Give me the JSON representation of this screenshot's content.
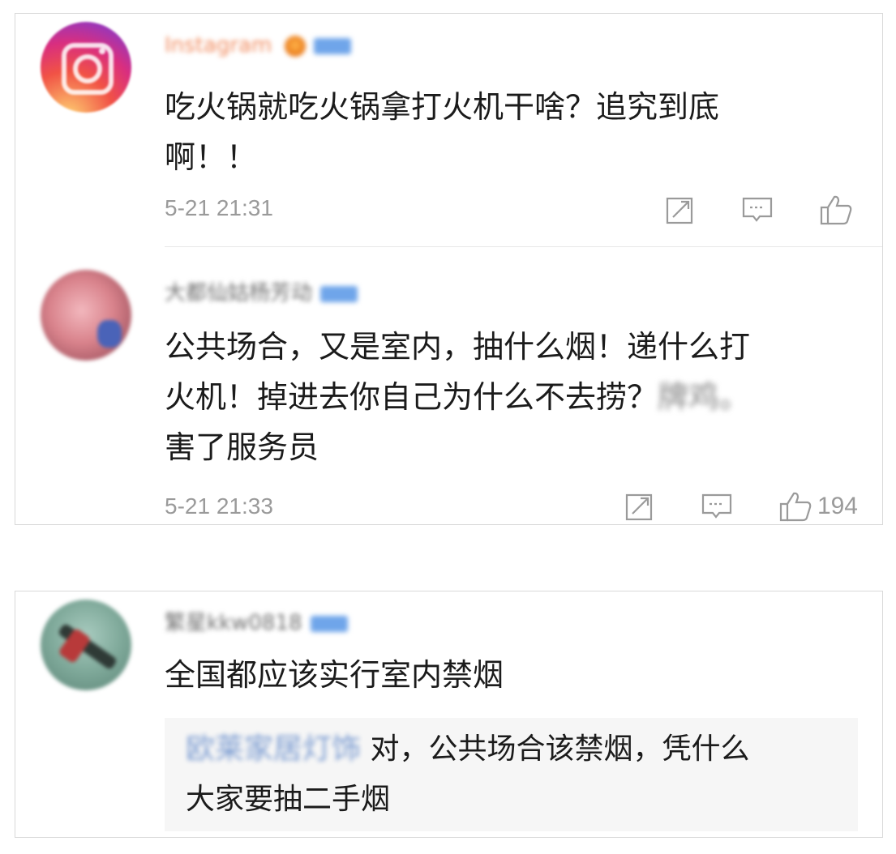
{
  "comments": [
    {
      "username": "Instagram",
      "text_line1": "吃火锅就吃火锅拿打火机干啥？追究到底",
      "text_line2": "啊！！",
      "time": "5-21 21:31",
      "like_count": ""
    },
    {
      "username": "大都仙姑杨芳动",
      "text_line1": "公共场合，又是室内，抽什么烟！递什么打",
      "text_line2_prefix": "火机！掉进去你自己为什么不去捞？",
      "text_line2_blurred": "牌鸡。",
      "text_line3": "害了服务员",
      "time": "5-21 21:33",
      "like_count": "194"
    },
    {
      "username": "繁星kkw0818",
      "text_line1": "全国都应该实行室内禁烟",
      "reply": {
        "username": "欧莱家居灯饰",
        "text_line1": "对，公共场合该禁烟，凭什么",
        "text_line2": "大家要抽二手烟"
      }
    }
  ],
  "icons": {
    "repost": "repost-icon",
    "comment": "comment-icon",
    "like": "like-icon"
  },
  "colors": {
    "time": "#9a9a9a",
    "vip_badge": "#6fa5ea",
    "reply_bg": "#f6f6f6"
  }
}
